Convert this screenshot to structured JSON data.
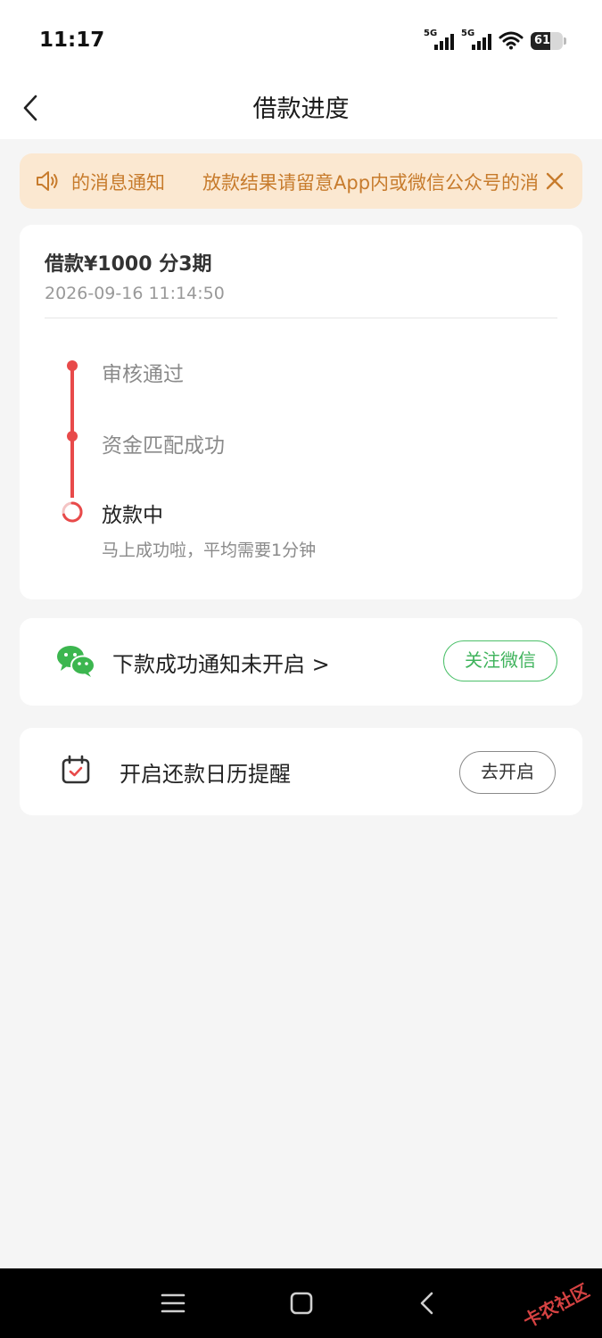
{
  "status_bar": {
    "time": "11:17",
    "signal_1_label": "5G",
    "signal_2_label": "5G",
    "battery": "61",
    "battery_level_percent": 61
  },
  "header": {
    "title": "借款进度",
    "back_icon": "chevron-left-icon"
  },
  "notice": {
    "icon": "speaker-icon",
    "text": "的消息通知　　放款结果请留意App内或微信公众号的消",
    "close_icon": "close-icon",
    "text_color": "#c77b2c",
    "background": "#fbe8d1"
  },
  "loan": {
    "title": "借款¥1000  分3期",
    "time": "2026-09-16 11:14:50",
    "steps": [
      {
        "label": "审核通过",
        "state": "done"
      },
      {
        "label": "资金匹配成功",
        "state": "done"
      },
      {
        "label": "放款中",
        "state": "in-progress",
        "sub": "马上成功啦，平均需要1分钟"
      }
    ],
    "accent_color": "#e84a4a"
  },
  "wechat": {
    "icon": "wechat-icon",
    "text": "下款成功通知未开启 >",
    "button": "关注微信",
    "accent_color": "#3fb35c"
  },
  "calendar": {
    "icon": "calendar-check-icon",
    "text": "开启还款日历提醒",
    "button": "去开启"
  },
  "nav_bar": {
    "menu_icon": "menu-icon",
    "home_icon": "home-square-icon",
    "back_icon": "back-triangle-icon",
    "watermark": "卡农社区"
  }
}
